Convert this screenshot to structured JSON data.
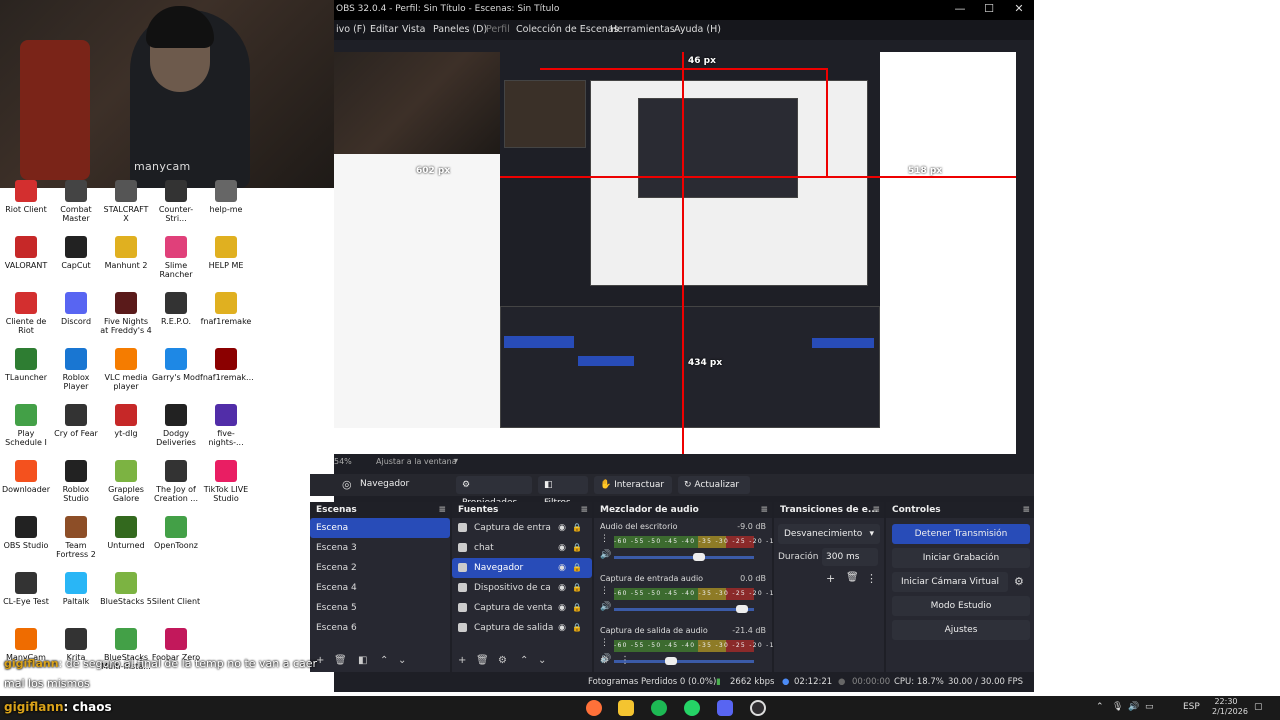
{
  "webcam": {
    "watermark": "manycam"
  },
  "desktop": {
    "icons": [
      {
        "label": "Riot Client",
        "color": "#d32f2f"
      },
      {
        "label": "Combat Master",
        "color": "#444"
      },
      {
        "label": "STALCRAFT X",
        "color": "#555"
      },
      {
        "label": "Counter-Stri...",
        "color": "#333"
      },
      {
        "label": "help-me",
        "color": "#666"
      },
      {
        "label": "VALORANT",
        "color": "#c62828"
      },
      {
        "label": "CapCut",
        "color": "#222"
      },
      {
        "label": "Manhunt 2",
        "color": "#e0b020"
      },
      {
        "label": "Slime Rancher",
        "color": "#e0407a"
      },
      {
        "label": "HELP ME",
        "color": "#e0b020"
      },
      {
        "label": "Cliente de Riot",
        "color": "#d32f2f"
      },
      {
        "label": "Discord",
        "color": "#5865f2"
      },
      {
        "label": "Five Nights at Freddy's 4",
        "color": "#5a1a1a"
      },
      {
        "label": "R.E.P.O.",
        "color": "#333"
      },
      {
        "label": "fnaf1remake",
        "color": "#e0b020"
      },
      {
        "label": "TLauncher",
        "color": "#2e7d32"
      },
      {
        "label": "Roblox Player",
        "color": "#1976d2"
      },
      {
        "label": "VLC media player",
        "color": "#f57c00"
      },
      {
        "label": "Garry's Mod",
        "color": "#1e88e5"
      },
      {
        "label": "fnaf1remak...",
        "color": "#8b0000"
      },
      {
        "label": "Play Schedule I",
        "color": "#43a047"
      },
      {
        "label": "Cry of Fear",
        "color": "#333"
      },
      {
        "label": "yt-dlg",
        "color": "#c62828"
      },
      {
        "label": "Dodgy Deliveries",
        "color": "#222"
      },
      {
        "label": "five-nights-...",
        "color": "#512da8"
      },
      {
        "label": "Downloader",
        "color": "#f4511e"
      },
      {
        "label": "Roblox Studio",
        "color": "#222"
      },
      {
        "label": "Grapples Galore",
        "color": "#7cb342"
      },
      {
        "label": "The Joy of Creation ...",
        "color": "#333"
      },
      {
        "label": "TikTok LIVE Studio",
        "color": "#e91e63"
      },
      {
        "label": "OBS Studio",
        "color": "#222"
      },
      {
        "label": "Team Fortress 2",
        "color": "#8d4e27"
      },
      {
        "label": "Unturned",
        "color": "#33691e"
      },
      {
        "label": "OpenToonz",
        "color": "#43a047"
      },
      {
        "label": "",
        "color": "#fff"
      },
      {
        "label": "CL-Eye Test",
        "color": "#333"
      },
      {
        "label": "Paltalk",
        "color": "#29b6f6"
      },
      {
        "label": "BlueStacks 5",
        "color": "#7cb342"
      },
      {
        "label": "Silent Client",
        "color": "#fff"
      },
      {
        "label": "",
        "color": "#fff"
      },
      {
        "label": "ManyCam",
        "color": "#ef6c00"
      },
      {
        "label": "Krita",
        "color": "#333"
      },
      {
        "label": "BlueStacks Multi-Insta...",
        "color": "#43a047"
      },
      {
        "label": "Foobar Zero",
        "color": "#c2185b"
      },
      {
        "label": "",
        "color": "#fff"
      }
    ]
  },
  "obs": {
    "title": "OBS 32.0.4 - Perfil: Sin Título - Escenas: Sin Título",
    "window_controls": [
      "—",
      "☐",
      "✕"
    ],
    "menu": [
      "ivo (F)",
      "Editar",
      "Vista",
      "Paneles (D)",
      "Perfil",
      "Colección de Escenas",
      "Herramientas",
      "Ayuda (H)"
    ],
    "measure_labels": [
      "46 px",
      "602 px",
      "518 px",
      "434 px"
    ],
    "zoom": {
      "value": "54%",
      "fit": "Ajustar a la ventana"
    },
    "source_toolbar": {
      "name": "Navegador",
      "buttons": [
        "Propiedades",
        "Filtros",
        "Interactuar",
        "Actualizar"
      ]
    },
    "scenes": {
      "title": "Escenas",
      "items": [
        "Escena",
        "Escena 3",
        "Escena 2",
        "Escena 4",
        "Escena 5",
        "Escena 6"
      ],
      "selected": 0
    },
    "sources": {
      "title": "Fuentes",
      "items": [
        "Captura de entra",
        "chat",
        "Navegador",
        "Dispositivo de ca",
        "Captura de venta",
        "Captura de salida"
      ],
      "selected": 2
    },
    "mixer": {
      "title": "Mezclador de audio",
      "channels": [
        {
          "name": "Audio del escritorio",
          "db": "-9.0 dB",
          "level": 0.62
        },
        {
          "name": "Captura de entrada audio",
          "db": "0.0 dB",
          "level": 0.95
        },
        {
          "name": "Captura de salida de audio",
          "db": "-21.4 dB",
          "level": 0.4
        }
      ],
      "ticks": "-60 -55 -50 -45 -40 -35 -30 -25 -20 -15 -10 -5 0"
    },
    "transitions": {
      "title": "Transiciones de e...",
      "type": "Desvanecimiento",
      "duration_label": "Duración",
      "duration": "300 ms"
    },
    "controls": {
      "title": "Controles",
      "buttons": [
        "Detener Transmisión",
        "Iniciar Grabación",
        "Iniciar Cámara Virtual",
        "Modo Estudio",
        "Ajustes"
      ]
    },
    "status": {
      "dropped": "Fotogramas Perdidos 0 (0.0%)",
      "bitrate": "2662 kbps",
      "stream_time": "02:12:21",
      "rec_time": "00:00:00",
      "cpu": "CPU: 18.7%",
      "fps": "30.00 / 30.00 FPS"
    }
  },
  "chat": [
    {
      "user": "gigiflann",
      "message": ": de seguro al final de la temp no te van a caer"
    },
    {
      "user": "",
      "message": "mal los mismos"
    },
    {
      "user": "gigiflann",
      "message": ": chaos"
    }
  ],
  "taskbar": {
    "lang": "ESP",
    "time": "22:30",
    "date": "2/1/2026",
    "apps": [
      "firefox",
      "files",
      "spotify",
      "whatsapp",
      "discord",
      "obs"
    ]
  }
}
